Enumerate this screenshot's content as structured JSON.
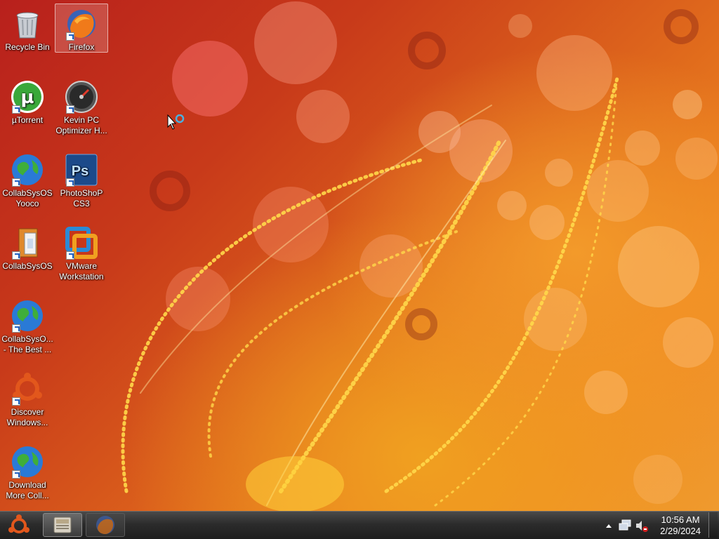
{
  "desktop": {
    "icons": [
      {
        "label": "Recycle Bin",
        "icon": "recycle-bin-icon"
      },
      {
        "label": "Firefox",
        "icon": "firefox-icon",
        "selected": true
      },
      {
        "label": "µTorrent",
        "icon": "utorrent-icon"
      },
      {
        "label": "Kevin PC\nOptimizer H...",
        "icon": "pc-optimizer-icon"
      },
      {
        "label": "CollabSysOS\nYooco",
        "icon": "globe-icon"
      },
      {
        "label": "PhotoShoP\nCS3",
        "icon": "photoshop-icon"
      },
      {
        "label": "CollabSysOS",
        "icon": "folder-doc-icon"
      },
      {
        "label": "VMware\nWorkstation",
        "icon": "vmware-icon"
      },
      {
        "label": "CollabSysO...\n- The Best ...",
        "icon": "globe-icon"
      },
      {
        "label": "Discover\nWindows...",
        "icon": "ubuntu-icon"
      },
      {
        "label": "Download\nMore Coll...",
        "icon": "globe-icon"
      }
    ]
  },
  "taskbar": {
    "start_icon": "ubuntu-start-icon",
    "buttons": [
      {
        "name": "file-manager",
        "icon": "file-manager-icon",
        "active": true
      },
      {
        "name": "firefox",
        "icon": "firefox-icon",
        "active": false
      }
    ],
    "tray": {
      "icons": [
        "show-hidden-icons-arrow",
        "network-icon",
        "volume-muted-icon"
      ],
      "time": "10:56 AM",
      "date": "2/29/2024"
    }
  },
  "colors": {
    "wallpaper_dark": "#b8201c",
    "wallpaper_light": "#f08a22",
    "taskbar": "#2c2c2c"
  }
}
